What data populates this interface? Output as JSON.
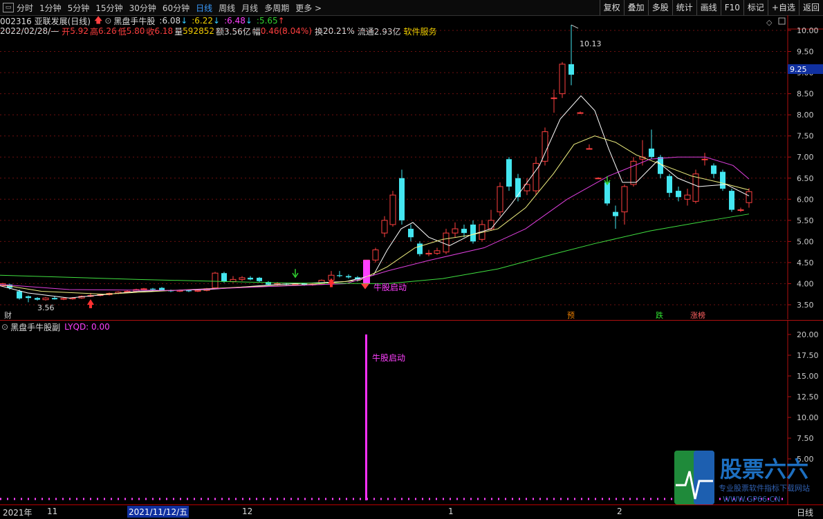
{
  "toolbar": {
    "periods": [
      "分时",
      "1分钟",
      "5分钟",
      "15分钟",
      "30分钟",
      "60分钟",
      "日线",
      "周线",
      "月线",
      "多周期",
      "更多"
    ],
    "active_period": "日线",
    "right_buttons": [
      "复权",
      "叠加",
      "多股",
      "统计",
      "画线",
      "F10",
      "标记",
      "+自选",
      "返回"
    ]
  },
  "quote": {
    "code_name": "002316 亚联发展(日线)",
    "indicator_name": "黑盘手牛股",
    "ma1_label": ":",
    "ma1_value": "6.08",
    "ma2_label": ":",
    "ma2_value": "6.22",
    "ma3_label": ":",
    "ma3_value": "6.48",
    "ma4_label": ":",
    "ma4_value": "5.65"
  },
  "ohlc": {
    "date": "2022/02/28/—",
    "open_label": "开",
    "open": "5.92",
    "high_label": "高",
    "high": "6.26",
    "low_label": "低",
    "low": "5.80",
    "close_label": "收",
    "close": "6.18",
    "vol_label": "量",
    "vol": "592852",
    "amt_label": "额",
    "amt": "3.56亿",
    "chg_label": "幅",
    "chg": "0.46(8.04%)",
    "turnover_label": "换",
    "turnover": "20.21%",
    "float_label": "流通",
    "float": "2.93亿",
    "sector": "软件服务"
  },
  "main_chart": {
    "y_ticks": [
      "10.00",
      "9.50",
      "9.00",
      "8.50",
      "8.00",
      "7.50",
      "7.00",
      "6.50",
      "6.00",
      "5.50",
      "5.00",
      "4.50",
      "4.00",
      "3.50"
    ],
    "current_price_tag": "9.25",
    "max_label": "10.13",
    "min_label": "3.56",
    "signal_label": "牛股启动",
    "markers": [
      "财",
      "预",
      "跌",
      "涨榜"
    ]
  },
  "sub_chart": {
    "name": "黑盘手牛股副",
    "value_label": "LYQD: 0.00",
    "signal_label": "牛股启动",
    "y_ticks": [
      "20.00",
      "17.50",
      "15.00",
      "12.50",
      "10.00",
      "7.50",
      "5.00"
    ]
  },
  "date_axis": {
    "labels": [
      "2021年",
      "11",
      "2021/11/12/五",
      "12",
      "1",
      "2"
    ],
    "period_label": "日线"
  },
  "logo": {
    "title": "股票六六",
    "subtitle": "专业股票软件指标下载网站",
    "url": "WWW.GP66.CN"
  },
  "colors": {
    "up": "#ff4040",
    "down": "#44e6f0",
    "ma_white": "#ffffff",
    "ma_yellow": "#f0f080",
    "ma_magenta": "#e040e0",
    "ma_green": "#40e040",
    "grid": "#801818",
    "signal": "#ff40ff"
  }
}
